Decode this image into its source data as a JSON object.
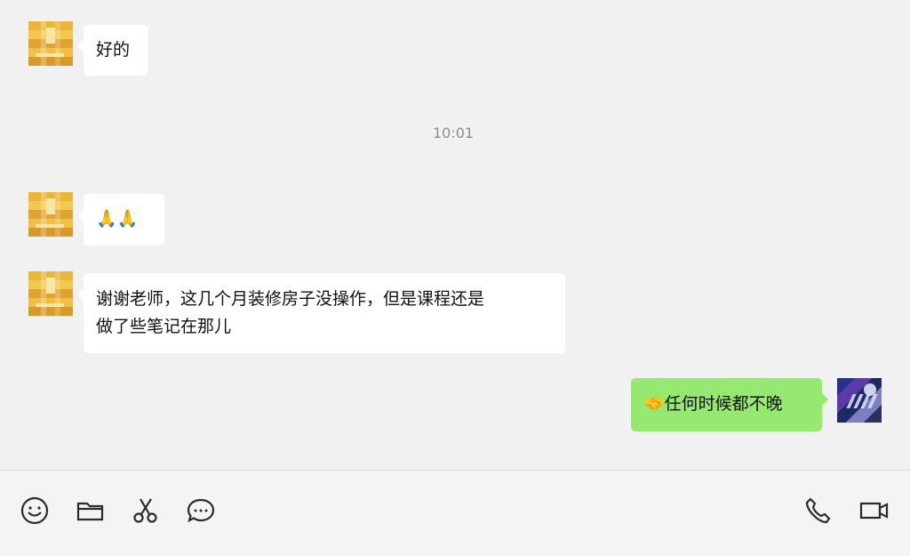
{
  "chat": {
    "messages": [
      {
        "side": "left",
        "text": "好的"
      },
      {
        "side": "left",
        "text": "🙏🙏"
      },
      {
        "side": "left",
        "line1": "谢谢老师，这几个月装修房子没操作，但是课程还是",
        "line2": "做了些笔记在那儿"
      },
      {
        "side": "right",
        "text": "🤝任何时候都不晚"
      }
    ],
    "timestamp": "10:01"
  },
  "toolbar": {
    "left_icons": [
      "emoji-icon",
      "folder-icon",
      "scissors-icon",
      "chat-bubble-icon"
    ],
    "right_icons": [
      "phone-icon",
      "video-camera-icon"
    ]
  },
  "colors": {
    "background": "#f1f1f1",
    "incoming_bubble": "#ffffff",
    "outgoing_bubble": "#96e970",
    "timestamp_text": "#8f8f8f",
    "icon_stroke": "#2b2b2b"
  }
}
